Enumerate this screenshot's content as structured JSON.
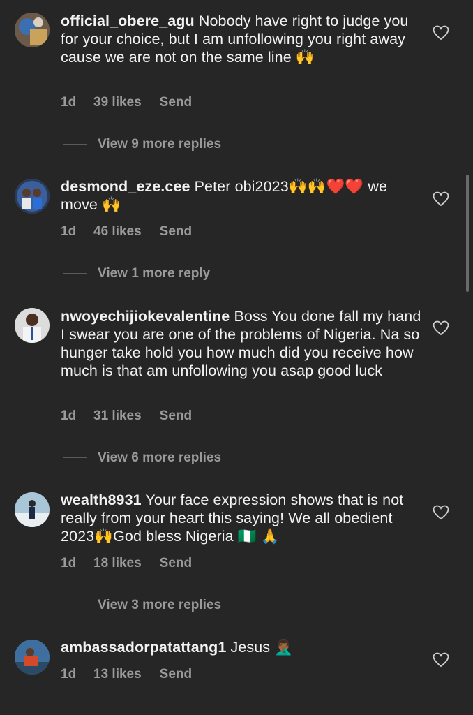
{
  "comments": [
    {
      "username": "official_obere_agu",
      "text": " Nobody have right to judge you for your choice, but I am unfollowing you right away cause we are not on the same line 🙌",
      "time": "1d",
      "likes": "39 likes",
      "send": "Send",
      "replies": "View 9 more replies"
    },
    {
      "username": "desmond_eze.cee",
      "text": " Peter obi2023🙌🙌❤️❤️ we move 🙌",
      "time": "1d",
      "likes": "46 likes",
      "send": "Send",
      "replies": "View 1 more reply"
    },
    {
      "username": "nwoyechijiokevalentine",
      "text": " Boss You done fall my hand I swear you are one of the problems of Nigeria. Na so hunger take hold you how much did you receive how much is that am unfollowing you asap good luck",
      "time": "1d",
      "likes": "31 likes",
      "send": "Send",
      "replies": "View 6 more replies"
    },
    {
      "username": "wealth8931",
      "text": " Your face expression shows that is not really from your heart this saying! We all obedient 2023🙌God bless Nigeria 🇳🇬 🙏",
      "time": "1d",
      "likes": "18 likes",
      "send": "Send",
      "replies": "View 3 more replies"
    },
    {
      "username": "ambassadorpatattang1",
      "text": " Jesus 🤦🏾‍♂️",
      "time": "1d",
      "likes": "13 likes",
      "send": "Send"
    }
  ],
  "icons": {
    "like": "heart-outline-icon"
  },
  "colors": {
    "background": "#262626",
    "text": "#f2f2f2",
    "muted": "#9a9a9a"
  }
}
